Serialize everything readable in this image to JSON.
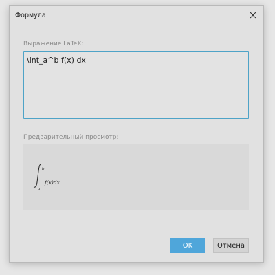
{
  "dialog": {
    "title": "Формула",
    "close_icon": "close-icon"
  },
  "latex": {
    "label": "Выражение LaTeX:",
    "value": "\\int_a^b f(x) dx"
  },
  "preview": {
    "label": "Предварительный просмотр:",
    "upper_limit": "b",
    "lower_limit": "a",
    "body": "f(x)dx"
  },
  "buttons": {
    "ok_label": "OK",
    "cancel_label": "Отмена"
  },
  "colors": {
    "focus_border": "#4ea3c7",
    "ok_button": "#4fa6da"
  }
}
